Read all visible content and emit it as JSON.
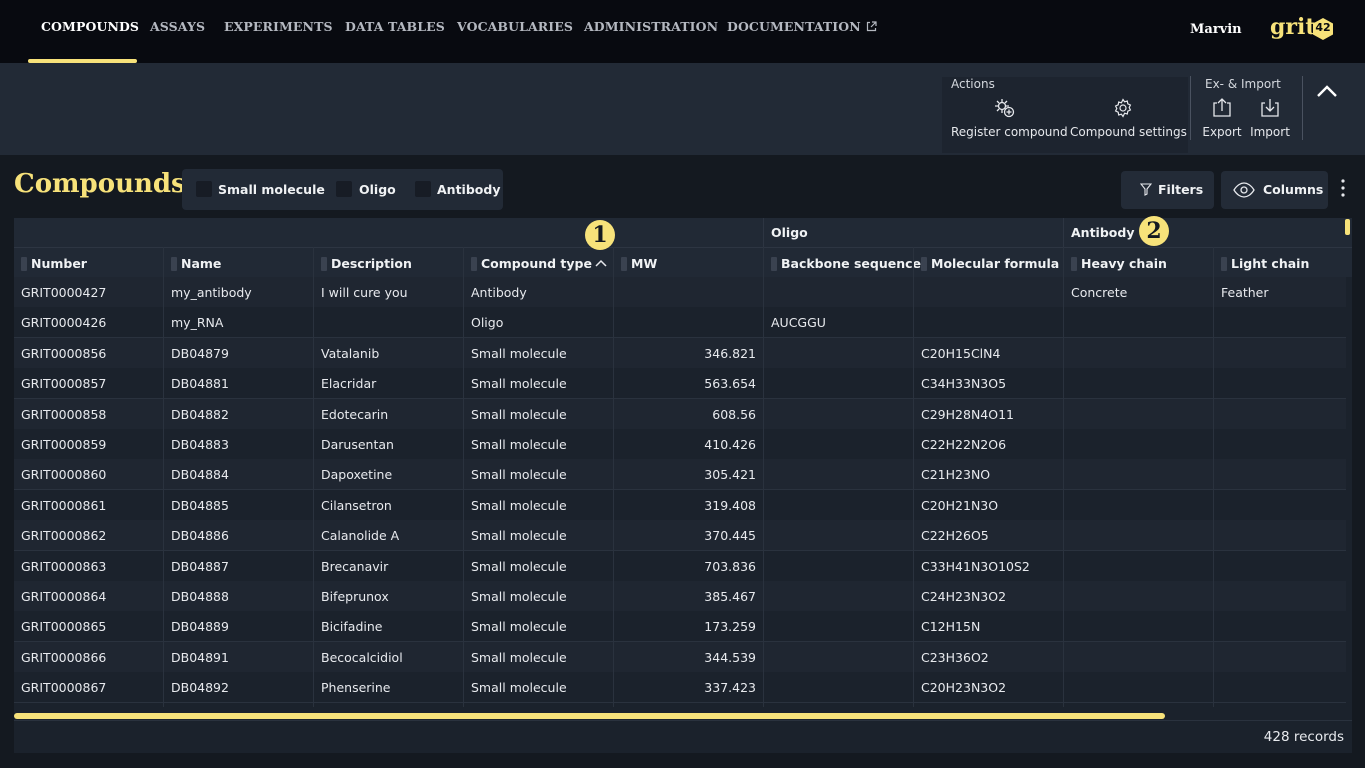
{
  "nav": {
    "items": [
      {
        "label": "COMPOUNDS",
        "active": true
      },
      {
        "label": "ASSAYS"
      },
      {
        "label": "EXPERIMENTS"
      },
      {
        "label": "DATA TABLES"
      },
      {
        "label": "VOCABULARIES"
      },
      {
        "label": "ADMINISTRATION"
      },
      {
        "label": "DOCUMENTATION",
        "icon": "external-link-icon"
      }
    ],
    "user": "Marvin",
    "logo_text": "grit",
    "logo_num": "42"
  },
  "toolbar": {
    "actions_title": "Actions",
    "register_compound": "Register compound",
    "compound_settings": "Compound settings",
    "exim_title": "Ex- & Import",
    "export": "Export",
    "import": "Import"
  },
  "page": {
    "title": "Compounds",
    "type_filters": [
      "Small molecule",
      "Oligo",
      "Antibody"
    ],
    "filters_label": "Filters",
    "columns_label": "Columns"
  },
  "grid": {
    "groups": {
      "oligo": "Oligo",
      "antibody": "Antibody"
    },
    "headers": [
      "Number",
      "Name",
      "Description",
      "Compound type",
      "MW",
      "Backbone sequence",
      "Molecular formula",
      "Heavy chain",
      "Light chain"
    ],
    "sorted_column": "Compound type",
    "sort_direction": "ascending",
    "rows": [
      [
        "GRIT0000427",
        "my_antibody",
        "I will cure you",
        "Antibody",
        "",
        "",
        "",
        "Concrete",
        "Feather"
      ],
      [
        "GRIT0000426",
        "my_RNA",
        "",
        "Oligo",
        "",
        "AUCGGU",
        "",
        "",
        ""
      ],
      [
        "GRIT0000856",
        "DB04879",
        "Vatalanib",
        "Small molecule",
        "346.821",
        "",
        "C20H15ClN4",
        "",
        ""
      ],
      [
        "GRIT0000857",
        "DB04881",
        "Elacridar",
        "Small molecule",
        "563.654",
        "",
        "C34H33N3O5",
        "",
        ""
      ],
      [
        "GRIT0000858",
        "DB04882",
        "Edotecarin",
        "Small molecule",
        "608.56",
        "",
        "C29H28N4O11",
        "",
        ""
      ],
      [
        "GRIT0000859",
        "DB04883",
        "Darusentan",
        "Small molecule",
        "410.426",
        "",
        "C22H22N2O6",
        "",
        ""
      ],
      [
        "GRIT0000860",
        "DB04884",
        "Dapoxetine",
        "Small molecule",
        "305.421",
        "",
        "C21H23NO",
        "",
        ""
      ],
      [
        "GRIT0000861",
        "DB04885",
        "Cilansetron",
        "Small molecule",
        "319.408",
        "",
        "C20H21N3O",
        "",
        ""
      ],
      [
        "GRIT0000862",
        "DB04886",
        "Calanolide A",
        "Small molecule",
        "370.445",
        "",
        "C22H26O5",
        "",
        ""
      ],
      [
        "GRIT0000863",
        "DB04887",
        "Brecanavir",
        "Small molecule",
        "703.836",
        "",
        "C33H41N3O10S2",
        "",
        ""
      ],
      [
        "GRIT0000864",
        "DB04888",
        "Bifeprunox",
        "Small molecule",
        "385.467",
        "",
        "C24H23N3O2",
        "",
        ""
      ],
      [
        "GRIT0000865",
        "DB04889",
        "Bicifadine",
        "Small molecule",
        "173.259",
        "",
        "C12H15N",
        "",
        ""
      ],
      [
        "GRIT0000866",
        "DB04891",
        "Becocalcidiol",
        "Small molecule",
        "344.539",
        "",
        "C23H36O2",
        "",
        ""
      ],
      [
        "GRIT0000867",
        "DB04892",
        "Phenserine",
        "Small molecule",
        "337.423",
        "",
        "C20H23N3O2",
        "",
        ""
      ]
    ]
  },
  "callouts": [
    "1",
    "2"
  ],
  "footer": {
    "records": "428 records"
  },
  "colors": {
    "accent": "#f7e27a",
    "nav_bg": "#080a10",
    "toolbar_bg": "#222a36",
    "grid_bg": "#1b222c"
  }
}
